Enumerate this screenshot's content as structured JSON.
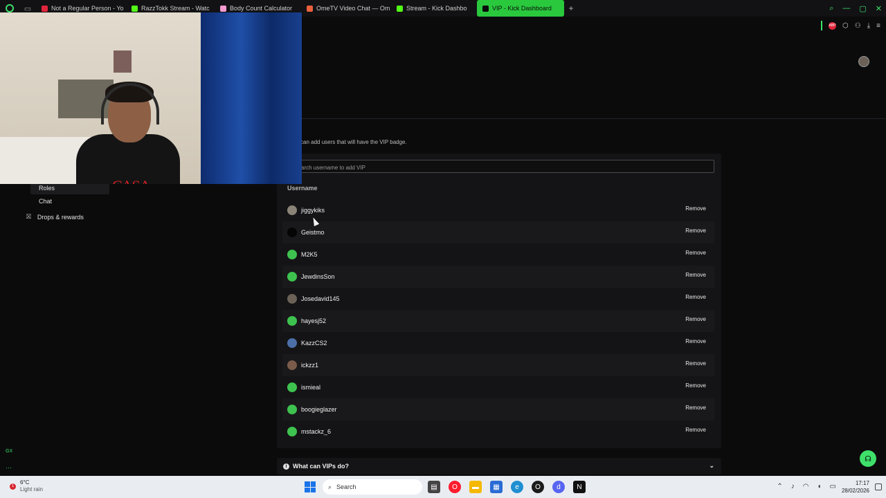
{
  "browser": {
    "tabs": [
      {
        "label": "Not a Regular Person - Yo",
        "favicon_color": "#e0243b"
      },
      {
        "label": "RazzTokk Stream - Watc",
        "favicon_color": "#53fc18"
      },
      {
        "label": "Body Count Calculator",
        "favicon_color": "#f29bd0"
      },
      {
        "label": "OmeTV Video Chat — Om",
        "favicon_color": "#e8603c"
      },
      {
        "label": "Stream - Kick Dashbo",
        "favicon_color": "#53fc18"
      },
      {
        "label": "VIP - Kick Dashboard",
        "favicon_color": "#0b0b0c",
        "active": true
      }
    ],
    "new_tab": "+",
    "adblock_label": "ABP"
  },
  "page": {
    "description": "can add users that will have the VIP badge.",
    "search_placeholder": "arch username to add VIP",
    "column_header": "Username",
    "remove_label": "Remove",
    "faq_title": "What can VIPs do?",
    "vips": [
      {
        "name": "jiggykiks",
        "avatar_color": "#8b8378"
      },
      {
        "name": "Geistmo",
        "avatar_color": "#050505"
      },
      {
        "name": "M2K5",
        "avatar_color": "#3ec24f"
      },
      {
        "name": "JewdinsSon",
        "avatar_color": "#3ec24f"
      },
      {
        "name": "Josedavid145",
        "avatar_color": "#6b6157"
      },
      {
        "name": "hayesj52",
        "avatar_color": "#3ec24f"
      },
      {
        "name": "KazzCS2",
        "avatar_color": "#4c6fa8"
      },
      {
        "name": "ickzz1",
        "avatar_color": "#7a5b4a"
      },
      {
        "name": "ismieal",
        "avatar_color": "#3ec24f"
      },
      {
        "name": "boogieglazer",
        "avatar_color": "#3ec24f"
      },
      {
        "name": "mstackz_6",
        "avatar_color": "#3ec24f"
      }
    ]
  },
  "sidebar": {
    "roles": "Roles",
    "chat": "Chat",
    "drops": "Drops & rewards"
  },
  "webcam": {
    "shirt_text": "CASA"
  },
  "left_rail": {
    "gx": "GX",
    "more": "…"
  },
  "taskbar": {
    "weather_badge": "1",
    "temperature": "6°C",
    "condition": "Light rain",
    "search_label": "Search",
    "time": "17:17",
    "date": "28/02/2026"
  },
  "colors": {
    "accent": "#53fc18",
    "background": "#0b0b0c",
    "panel": "#141416"
  }
}
